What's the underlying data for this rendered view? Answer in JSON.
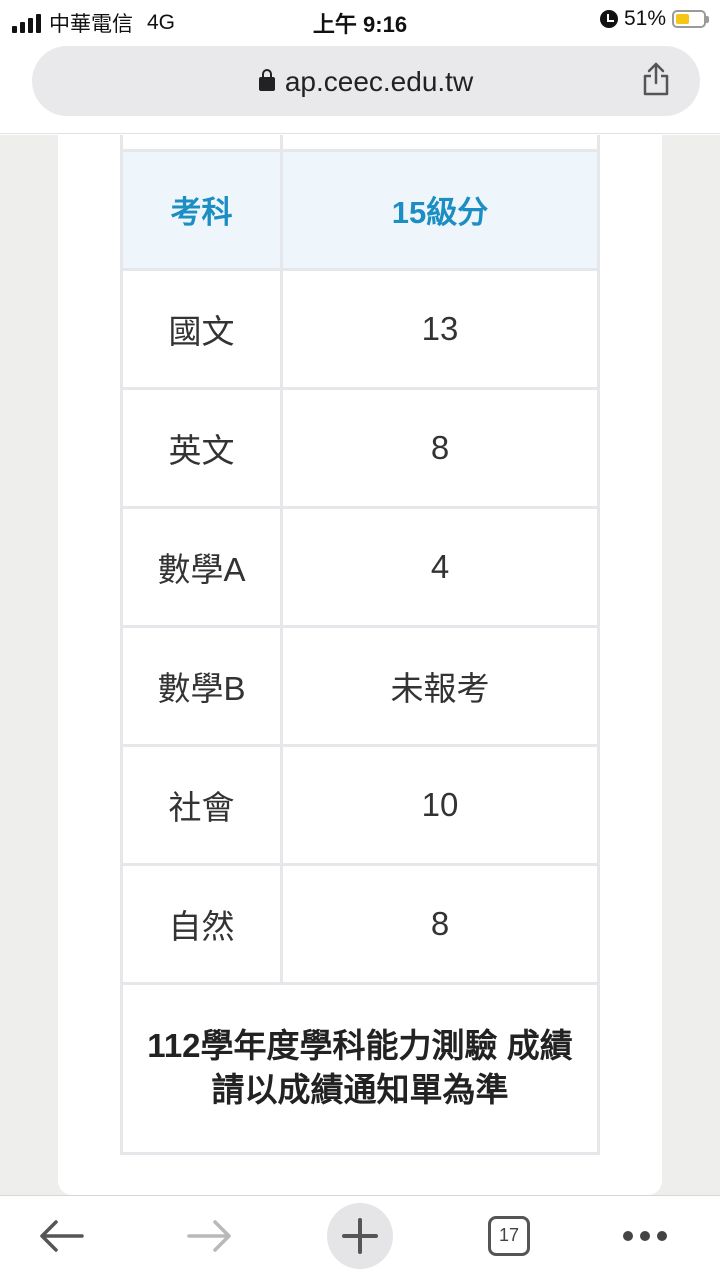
{
  "status_bar": {
    "carrier": "中華電信",
    "network": "4G",
    "time": "上午 9:16",
    "battery": "51%",
    "battery_level": 0.51,
    "battery_color": "#f5c518"
  },
  "browser": {
    "url": "ap.ceec.edu.tw",
    "tab_count": "17",
    "icons": [
      "lock-icon",
      "share-icon",
      "back-icon",
      "forward-icon",
      "new-tab-icon",
      "tabs-icon",
      "more-icon"
    ]
  },
  "table": {
    "header": {
      "subject": "考科",
      "level": "15級分"
    },
    "rows": [
      {
        "subject": "國文",
        "score": "13"
      },
      {
        "subject": "英文",
        "score": "8"
      },
      {
        "subject": "數學A",
        "score": "4"
      },
      {
        "subject": "數學B",
        "score": "未報考"
      },
      {
        "subject": "社會",
        "score": "10"
      },
      {
        "subject": "自然",
        "score": "8"
      }
    ],
    "note": "112學年度學科能力測驗 成績請以成績通知單為準"
  },
  "colors": {
    "header_text": "#1c8ec4",
    "header_bg": "#eef6fb"
  }
}
